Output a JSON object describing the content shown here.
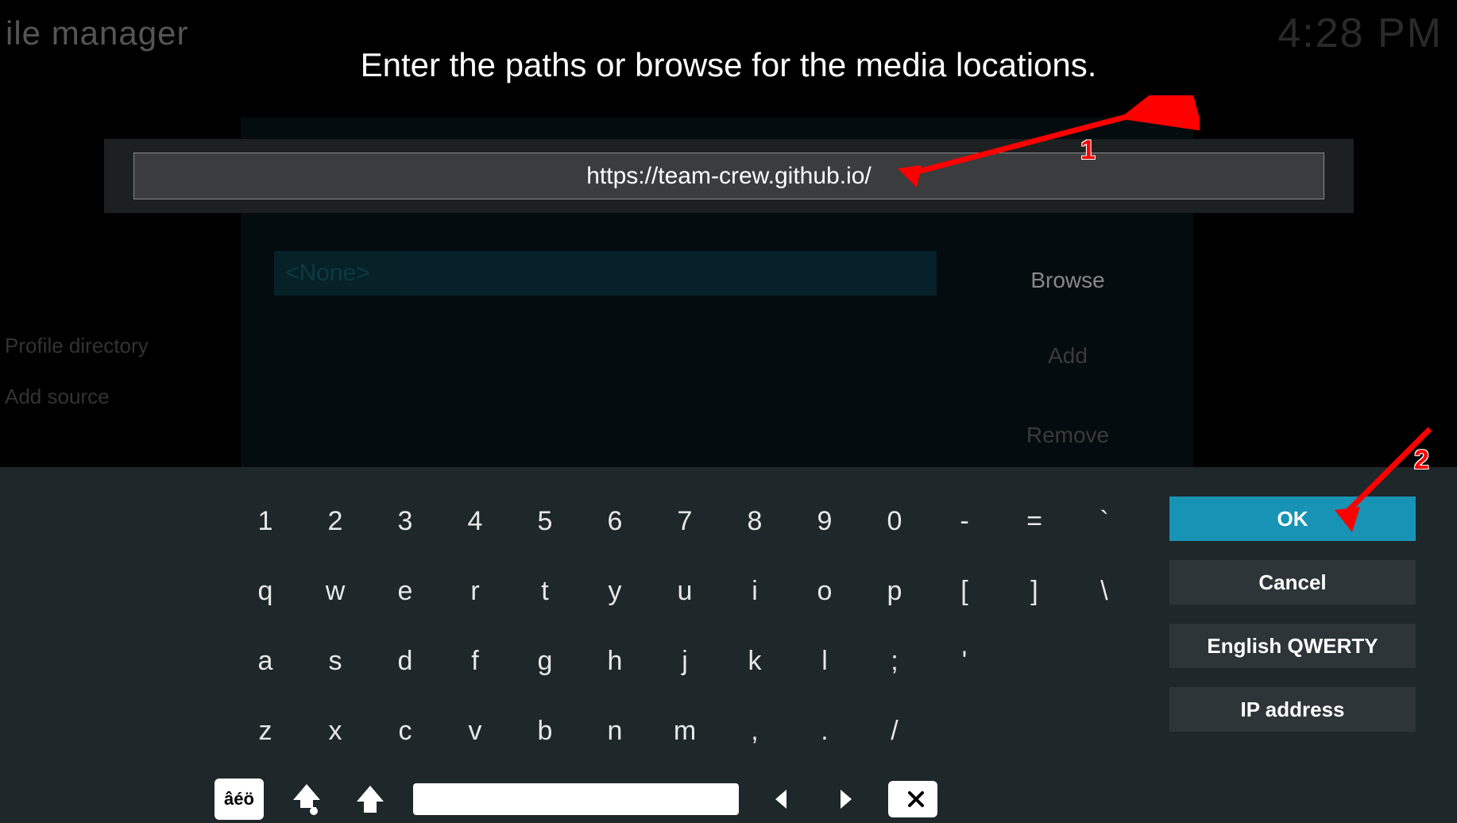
{
  "header": {
    "title_fragment": "ile manager",
    "clock": "4:28 PM"
  },
  "background": {
    "side_label_1": "Profile directory",
    "side_label_2": "Add source",
    "none_placeholder": "<None>",
    "browse": "Browse",
    "add": "Add",
    "remove": "Remove"
  },
  "dialog": {
    "prompt": "Enter the paths or browse for the media locations.",
    "input_value": "https://team-crew.github.io/"
  },
  "keyboard": {
    "rows": [
      [
        "1",
        "2",
        "3",
        "4",
        "5",
        "6",
        "7",
        "8",
        "9",
        "0",
        "-",
        "=",
        "`"
      ],
      [
        "q",
        "w",
        "e",
        "r",
        "t",
        "y",
        "u",
        "i",
        "o",
        "p",
        "[",
        "]",
        "\\"
      ],
      [
        "a",
        "s",
        "d",
        "f",
        "g",
        "h",
        "j",
        "k",
        "l",
        ";",
        "'"
      ],
      [
        "z",
        "x",
        "c",
        "v",
        "b",
        "n",
        "m",
        ",",
        ".",
        "/"
      ]
    ],
    "accent_key": "âéö",
    "side_buttons": {
      "ok": "OK",
      "cancel": "Cancel",
      "layout": "English QWERTY",
      "ip": "IP address"
    }
  },
  "annotations": {
    "n1": "1",
    "n2": "2"
  }
}
